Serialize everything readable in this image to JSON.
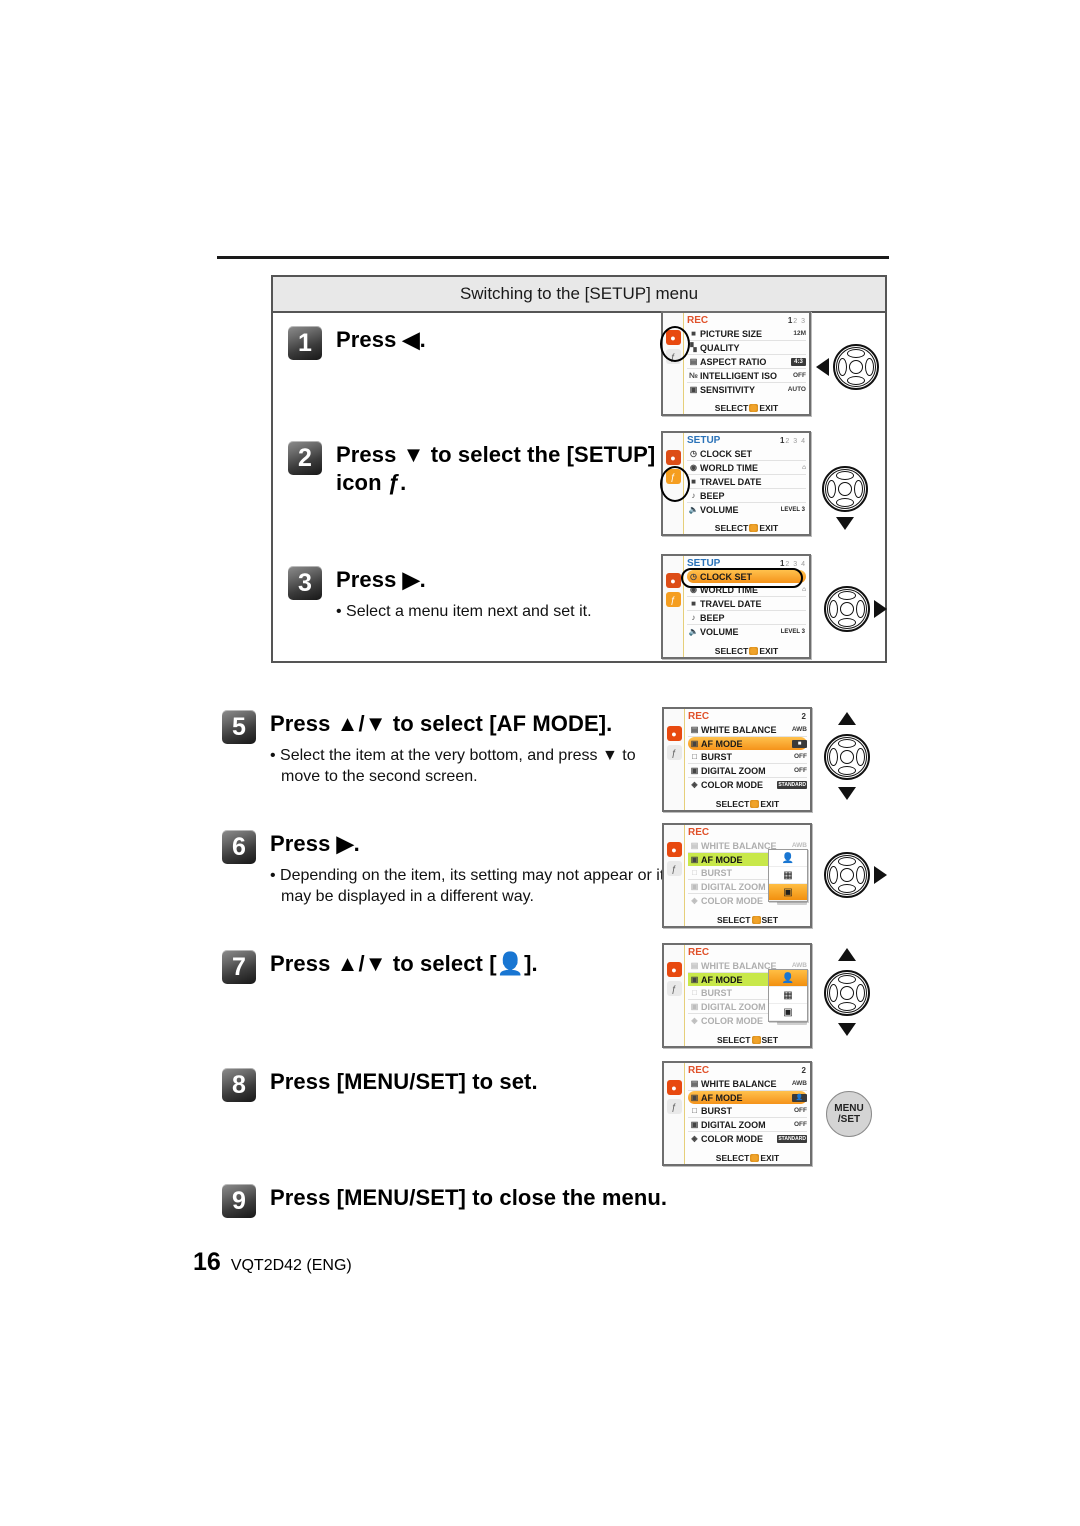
{
  "footer": {
    "page_number": "16",
    "doc_code": "VQT2D42 (ENG)"
  },
  "section": {
    "heading": "Switching to the [SETUP] menu"
  },
  "steps": [
    {
      "number": "1",
      "title": "Press ◀.",
      "bullet": "",
      "control": "cursor-pad-left"
    },
    {
      "number": "2",
      "title_line1": "Press ▼ to select the [SETUP] menu",
      "title_line2": "icon ƒ.",
      "bullet": "",
      "control": "cursor-pad-down"
    },
    {
      "number": "3",
      "title": "Press ▶.",
      "bullet": "• Select a menu item next and set it.",
      "control": "cursor-pad-right"
    },
    {
      "number": "5",
      "title": "Press ▲/▼ to select [AF MODE].",
      "bullet_line1": "• Select the item at the very bottom, and press ▼ to",
      "bullet_line2": "move to the second screen.",
      "control": "cursor-pad-updown"
    },
    {
      "number": "6",
      "title": "Press ▶.",
      "bullet_line1": "• Depending on the item, its setting may not appear or it",
      "bullet_line2": "may be displayed in a different way.",
      "control": "cursor-pad-right"
    },
    {
      "number": "7",
      "title_pre": "Press ▲/▼ to select [",
      "title_post": "].",
      "bullet": "",
      "control": "cursor-pad-updown"
    },
    {
      "number": "8",
      "title": "Press [MENU/SET] to set.",
      "bullet": "",
      "control": "menu-set-button"
    },
    {
      "number": "9",
      "title": "Press [MENU/SET] to close the menu.",
      "bullet": "",
      "control": ""
    }
  ],
  "menu_button": {
    "line1": "MENU",
    "line2": "/SET"
  },
  "screens": {
    "rec_page1": {
      "title": "REC",
      "page_current": "1",
      "page_rest": "2 3",
      "rows": [
        {
          "label": "PICTURE SIZE",
          "value": "12M"
        },
        {
          "label": "QUALITY",
          "value": ""
        },
        {
          "label": "ASPECT RATIO",
          "value": "4:3"
        },
        {
          "label": "INTELLIGENT ISO",
          "value": "OFF"
        },
        {
          "label": "SENSITIVITY",
          "value": "AUTO"
        }
      ],
      "footer_left": "SELECT",
      "footer_right": "EXIT"
    },
    "setup_page1": {
      "title": "SETUP",
      "page_current": "1",
      "page_rest": "2 3 4",
      "rows": [
        {
          "label": "CLOCK SET",
          "value": ""
        },
        {
          "label": "WORLD TIME",
          "value": "⌂"
        },
        {
          "label": "TRAVEL DATE",
          "value": ""
        },
        {
          "label": "BEEP",
          "value": ""
        },
        {
          "label": "VOLUME",
          "value": "LEVEL 3"
        }
      ],
      "footer_left": "SELECT",
      "footer_right": "EXIT"
    },
    "setup_page1_selected": {
      "title": "SETUP",
      "page_current": "1",
      "page_rest": "2 3 4",
      "rows": [
        {
          "label": "CLOCK SET",
          "value": "",
          "selected": true
        },
        {
          "label": "WORLD TIME",
          "value": "⌂"
        },
        {
          "label": "TRAVEL DATE",
          "value": ""
        },
        {
          "label": "BEEP",
          "value": ""
        },
        {
          "label": "VOLUME",
          "value": "LEVEL 3"
        }
      ],
      "footer_left": "SELECT",
      "footer_right": "EXIT"
    },
    "rec_page2_afmode": {
      "title": "REC",
      "page_current": "2",
      "page_rest": "",
      "rows": [
        {
          "label": "WHITE BALANCE",
          "value": "AWB"
        },
        {
          "label": "AF MODE",
          "value": "■",
          "selected": true
        },
        {
          "label": "BURST",
          "value": "OFF"
        },
        {
          "label": "DIGITAL ZOOM",
          "value": "OFF"
        },
        {
          "label": "COLOR MODE",
          "value": "STANDARD"
        }
      ],
      "footer_left": "SELECT",
      "footer_right": "EXIT"
    },
    "rec_page2_submenu": {
      "title": "REC",
      "page_current": "",
      "page_rest": "",
      "rows": [
        {
          "label": "WHITE BALANCE",
          "value": "AWB"
        },
        {
          "label": "AF MODE",
          "value": ""
        },
        {
          "label": "BURST",
          "value": ""
        },
        {
          "label": "DIGITAL ZOOM",
          "value": ""
        },
        {
          "label": "COLOR MODE",
          "value": "STANDARD"
        }
      ],
      "submenu_options": [
        "face-detect",
        "multi-area",
        "spot"
      ],
      "submenu_selected_index": 2,
      "footer_left": "SELECT",
      "footer_right": "SET"
    },
    "rec_page2_submenu_face": {
      "title": "REC",
      "page_current": "",
      "page_rest": "",
      "rows": [
        {
          "label": "WHITE BALANCE",
          "value": "AWB"
        },
        {
          "label": "AF MODE",
          "value": ""
        },
        {
          "label": "BURST",
          "value": ""
        },
        {
          "label": "DIGITAL ZOOM",
          "value": ""
        },
        {
          "label": "COLOR MODE",
          "value": "STANDARD"
        }
      ],
      "submenu_options": [
        "face-detect",
        "multi-area",
        "spot"
      ],
      "submenu_selected_index": 0,
      "footer_left": "SELECT",
      "footer_right": "SET"
    },
    "rec_page2_set": {
      "title": "REC",
      "page_current": "2",
      "page_rest": "",
      "rows": [
        {
          "label": "WHITE BALANCE",
          "value": "AWB"
        },
        {
          "label": "AF MODE",
          "value": "face",
          "selected": true
        },
        {
          "label": "BURST",
          "value": "OFF"
        },
        {
          "label": "DIGITAL ZOOM",
          "value": "OFF"
        },
        {
          "label": "COLOR MODE",
          "value": "STANDARD"
        }
      ],
      "footer_left": "SELECT",
      "footer_right": "EXIT"
    }
  }
}
